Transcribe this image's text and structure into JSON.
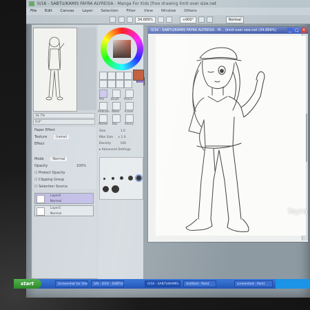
{
  "app": {
    "title": "0/16 - SABTU/KAMIS FAYRA ALYREISA - Manga For Kids [free drawing limit over size.net",
    "menus": [
      "File",
      "Edit",
      "Canvas",
      "Layer",
      "Selection",
      "Filter",
      "View",
      "Window",
      "Others"
    ]
  },
  "toolbar": {
    "zoom": "34.689%",
    "angle": "+000°",
    "normal_label": "Normal"
  },
  "navigator": {
    "zoom": "34.7%",
    "angle": "0.0°"
  },
  "layer_props": {
    "section": "Paper Effect",
    "texture_label": "Texture",
    "texture_value": "(none)",
    "effect_label": "Effect",
    "mode_label": "Mode",
    "mode_value": "Normal",
    "opacity_label": "Opacity",
    "opacity_value": "100%",
    "protect_label": "Protect Opacity",
    "clipping_label": "Clipping Group",
    "selection_source_label": "Selection Source"
  },
  "layers": [
    {
      "name": "Layer2",
      "mode": "Normal",
      "opacity": "100%"
    },
    {
      "name": "Layer1",
      "mode": "Normal",
      "opacity": "100%"
    }
  ],
  "tool_panel": {
    "brush_label": "Brush",
    "size_label": "Size",
    "max_size_label": "Max Size",
    "density_label": "Density",
    "advanced_label": "Advanced Settings",
    "size_value": "1.0",
    "max_size_value": "x 1.0",
    "density_value": "100"
  },
  "tools": [
    "Pen",
    "Brush",
    "Pencil",
    "Airbrush",
    "Water",
    "Eraser",
    "Marker",
    "Blur",
    "Binary"
  ],
  "canvas_window": {
    "title": "0/16 - SABTU/KAMIS FAYRA ALYREISA - M... (limit over size.net (34.689%)"
  },
  "taskbar": {
    "start_label": "start",
    "tasks": [
      "Screenshot for Viewpoint...",
      "SAI - 0/16 - SABTU/KAM...",
      "0/16 - SABTU/KAMIS...",
      "Untitled - Paint",
      "screenshot - Paint"
    ]
  },
  "watermark": "fayra",
  "colors": {
    "primary": "#b8421e",
    "secondary": "#8a55c8"
  }
}
